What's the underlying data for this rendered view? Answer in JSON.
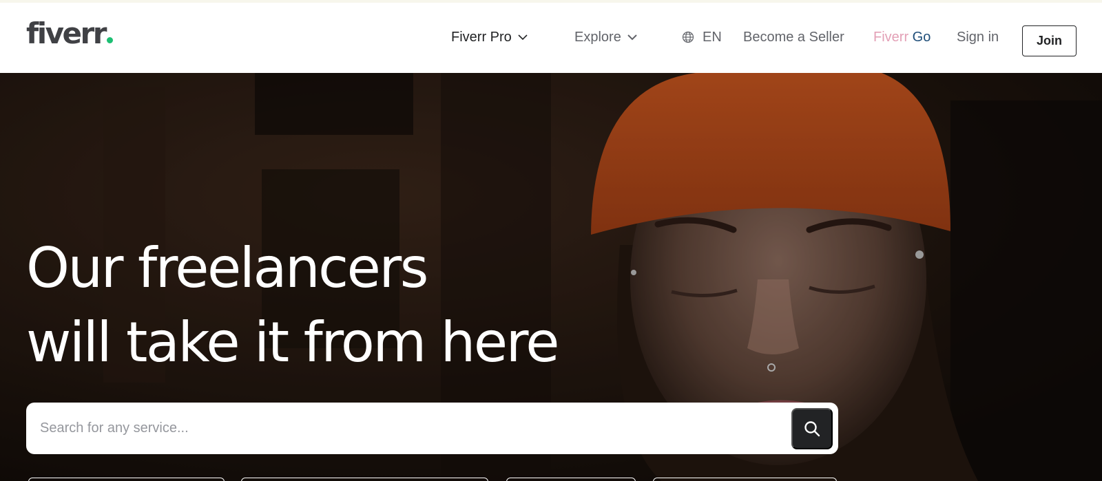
{
  "header": {
    "logo_text": "fiverr",
    "nav": {
      "fiverr_pro": "Fiverr Pro",
      "explore": "Explore",
      "language": "EN",
      "become_seller": "Become a Seller",
      "fiverr_go_first": "Fiverr",
      "fiverr_go_second": "Go",
      "sign_in": "Sign in",
      "join": "Join"
    }
  },
  "hero": {
    "headline_line1": "Our freelancers",
    "headline_line2": "will take it from here",
    "search_placeholder": "Search for any service..."
  },
  "colors": {
    "brand_green": "#1dbf73",
    "text_dark": "#222325",
    "text_gray": "#62646a",
    "go_pink": "#e3a0b6",
    "go_blue": "#1f4e79"
  },
  "icons": [
    "chevron-down-icon",
    "globe-icon",
    "search-icon"
  ]
}
